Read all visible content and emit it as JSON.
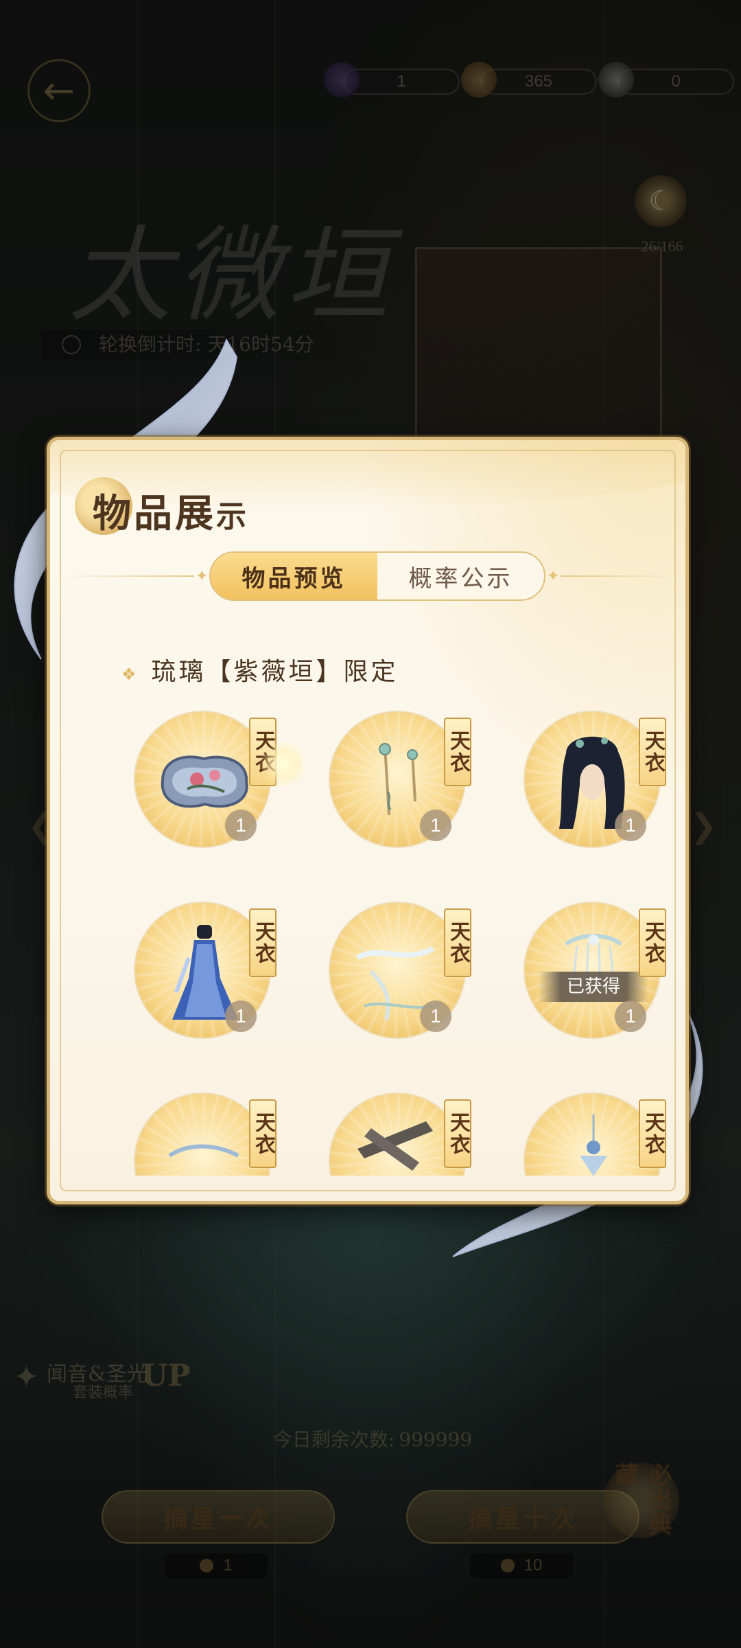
{
  "hud": {
    "currencies": [
      {
        "icon": "star-doll-icon",
        "value": "1"
      },
      {
        "icon": "gold-ingot-icon",
        "value": "365"
      },
      {
        "icon": "silver-orb-icon",
        "value": "0"
      }
    ],
    "moon_counter": "26/166"
  },
  "pool": {
    "title": "太微垣",
    "timer": "轮换倒计时:  天16时54分"
  },
  "up_banner": {
    "title": "闻音&圣光",
    "subtitle": "套装概率",
    "tag": "UP"
  },
  "draw": {
    "remaining_label": "今日剩余次数:",
    "remaining_value": "999999",
    "single_label": "摘星一次",
    "single_cost": "1",
    "ten_label": "摘星十次",
    "ten_cost": "10",
    "guarantee": "必出典藏"
  },
  "modal": {
    "title_main": "物品展",
    "title_tail": "示",
    "tabs": [
      {
        "label": "物品预览",
        "active": true
      },
      {
        "label": "概率公示",
        "active": false
      }
    ],
    "section_title": "琉璃【紫薇垣】限定",
    "items": [
      {
        "art": "porcelain-brooch",
        "badge": "天衣",
        "count": "1",
        "obtained": ""
      },
      {
        "art": "hairpins",
        "badge": "天衣",
        "count": "1",
        "obtained": ""
      },
      {
        "art": "black-hairstyle",
        "badge": "天衣",
        "count": "1",
        "obtained": ""
      },
      {
        "art": "blue-gown",
        "badge": "天衣",
        "count": "1",
        "obtained": ""
      },
      {
        "art": "silk-ribbon",
        "badge": "天衣",
        "count": "1",
        "obtained": ""
      },
      {
        "art": "crystal-headdress",
        "badge": "天衣",
        "count": "1",
        "obtained": "已获得"
      },
      {
        "art": "blue-accessory",
        "badge": "天衣",
        "count": "",
        "obtained": ""
      },
      {
        "art": "dark-branches",
        "badge": "天衣",
        "count": "",
        "obtained": ""
      },
      {
        "art": "jewel-pendant",
        "badge": "天衣",
        "count": "",
        "obtained": ""
      }
    ]
  },
  "colors": {
    "gold": "#d7b778",
    "tab_active": "#f2c15f",
    "modal_bg": "#fbf6ea",
    "text_dark": "#4b3520"
  }
}
